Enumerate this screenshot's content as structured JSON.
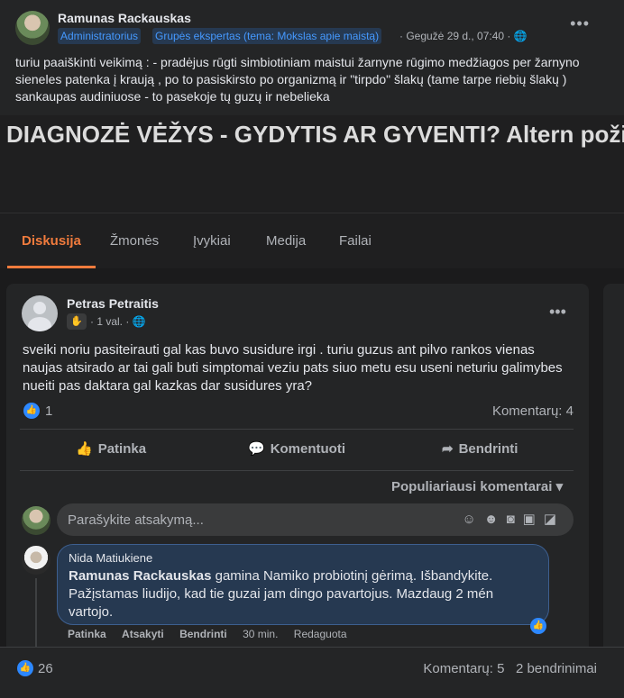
{
  "outer_post": {
    "author": "Ramunas Rackauskas",
    "badges": [
      "Administratorius",
      "Grupės ekspertas (tema: Mokslas apie maistą)"
    ],
    "meta": "· Gegužė 29 d., 07:40 · 🌐",
    "text": "turiu paaiškinti veikimą : - pradėjus rūgti simbiotiniam maistui žarnyne rūgimo medžiagos per žarnyno sieneles patenka į kraują , po to pasiskirsto po organizmą ir \"tirpdo\" šlakų (tame tarpe riebių šlakų ) sankaupas audiniuose - to pasekoje tų guzų ir nebelieka",
    "more": "•••"
  },
  "group": {
    "title": "DIAGNOZĖ VĖŽYS - GYDYTIS AR GYVENTI? Altern požiūris į onkologiją",
    "tabs": [
      "Diskusija",
      "Žmonės",
      "Įvykiai",
      "Medija",
      "Failai"
    ]
  },
  "post": {
    "author": "Petras Petraitis",
    "meta": "· 1 val. · 🌐",
    "text": "sveiki noriu pasiteirauti gal kas buvo susidure irgi . turiu guzus ant pilvo rankos vienas naujas atsirado ar tai gali buti simptomai veziu pats siuo metu esu useni neturiu galimybes nueiti pas daktara gal kazkas dar susidures yra?",
    "reactions": "1",
    "comments": "Komentarų: 4",
    "actions": {
      "like": "Patinka",
      "comment": "Komentuoti",
      "share": "Bendrinti"
    },
    "sort": "Populiariausi komentarai",
    "input_placeholder": "Parašykite atsakymą..."
  },
  "comment": {
    "author": "Nida Matiukiene",
    "mention": "Ramunas Rackauskas",
    "text": " gamina Namiko probiotinį gėrimą. Išbandykite. Pažįstamas liudijo, kad tie guzai jam dingo pavartojus. Mazdaug 2 mén vartojo.",
    "actions": [
      "Patinka",
      "Atsakyti",
      "Bendrinti",
      "30 min.",
      "Redaguota"
    ]
  },
  "bottom": {
    "reactions": "26",
    "comments": "Komentarų: 5",
    "shares": "2 bendrinimai"
  },
  "icons": [
    "globe-icon",
    "wave-icon",
    "like-icon",
    "comment-icon",
    "share-icon",
    "chevron-down-icon",
    "sticker-icon",
    "emoji-icon",
    "camera-icon",
    "gif-icon",
    "avatar-sticker-icon"
  ],
  "colors": {
    "accent": "#f07b3d",
    "link": "#4599ff",
    "like": "#2d88ff"
  }
}
